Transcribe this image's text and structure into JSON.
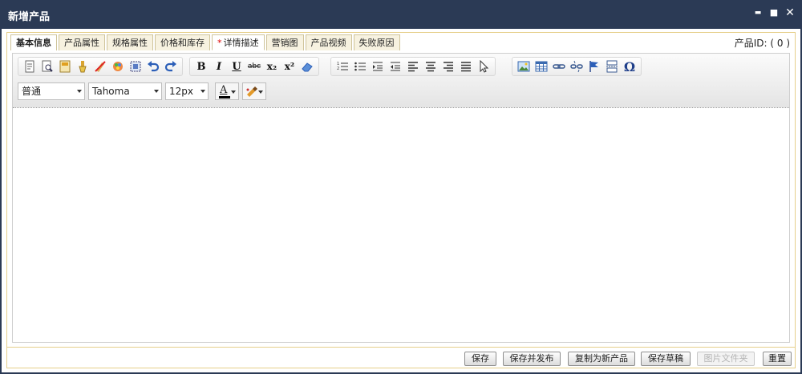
{
  "window": {
    "title": "新增产品",
    "controls": {
      "minimize": "▬",
      "maximize": "■",
      "close": "✕"
    }
  },
  "tabs": [
    {
      "label": "基本信息",
      "required": false
    },
    {
      "label": "产品属性",
      "required": false
    },
    {
      "label": "规格属性",
      "required": false
    },
    {
      "label": "价格和库存",
      "required": false
    },
    {
      "label": "详情描述",
      "required": true,
      "marker": "*"
    },
    {
      "label": "营销图",
      "required": false
    },
    {
      "label": "产品视频",
      "required": false
    },
    {
      "label": "失败原因",
      "required": false
    }
  ],
  "active_tab": "详情描述",
  "product_id": "产品ID: ( 0 )",
  "editor": {
    "format_labels": {
      "bold": "B",
      "italic": "I",
      "underline": "U",
      "strike": "abc",
      "subscript": "x₂",
      "superscript": "x²",
      "special_char": "Ω"
    },
    "paragraph_format": "普通",
    "font_family": "Tahoma",
    "font_size": "12px",
    "font_color_label": "A"
  },
  "colors": {
    "titlebar": "#2b3a55",
    "accent_border": "#e6cf8b",
    "required_marker": "#dd0000",
    "font_color_bar": "#000000"
  },
  "footer": {
    "save": "保存",
    "save_publish": "保存并发布",
    "copy_new": "复制为新产品",
    "save_draft": "保存草稿",
    "image_folder": "图片文件夹",
    "reset": "重置"
  }
}
